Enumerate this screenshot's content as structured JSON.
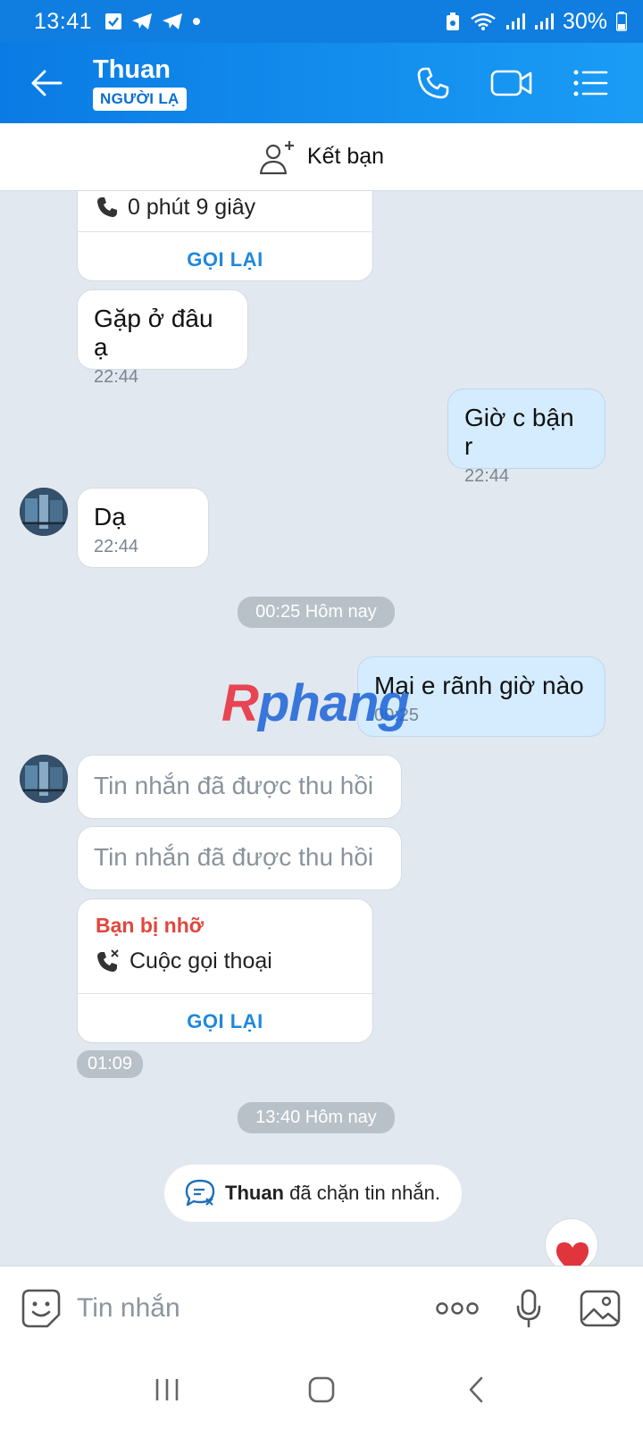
{
  "status_bar": {
    "time": "13:41",
    "battery": "30%"
  },
  "header": {
    "name": "Thuan",
    "badge": "NGƯỜI LẠ"
  },
  "add_friend": {
    "label": "Kết bạn"
  },
  "messages": {
    "call_top": {
      "duration": "0 phút 9 giây",
      "callback": "GỌI LẠI"
    },
    "m1": {
      "text": "Gặp ở đâu ạ",
      "time": "22:44"
    },
    "m2": {
      "text": "Giờ c bận r",
      "time": "22:44"
    },
    "m3": {
      "text": "Dạ",
      "time": "22:44"
    },
    "divider1": "00:25 Hôm nay",
    "m4": {
      "text": "Mai e rãnh giờ nào",
      "time": "00:25"
    },
    "recalled1": "Tin nhắn đã được thu hồi",
    "recalled2": "Tin nhắn đã được thu hồi",
    "missed_call": {
      "title": "Bạn bị nhỡ",
      "type": "Cuộc gọi thoại",
      "callback": "GỌI LẠI",
      "time": "01:09"
    },
    "divider2": "13:40 Hôm nay",
    "blocked": {
      "name": "Thuan",
      "text": "đã chặn tin nhắn."
    }
  },
  "watermark": {
    "first": "R",
    "rest": "phang"
  },
  "input": {
    "placeholder": "Tin nhắn"
  },
  "colors": {
    "header": "#0a7be4",
    "bubble_me": "#d4ecfd",
    "callback": "#1f88dc",
    "missed": "#e1463d"
  }
}
